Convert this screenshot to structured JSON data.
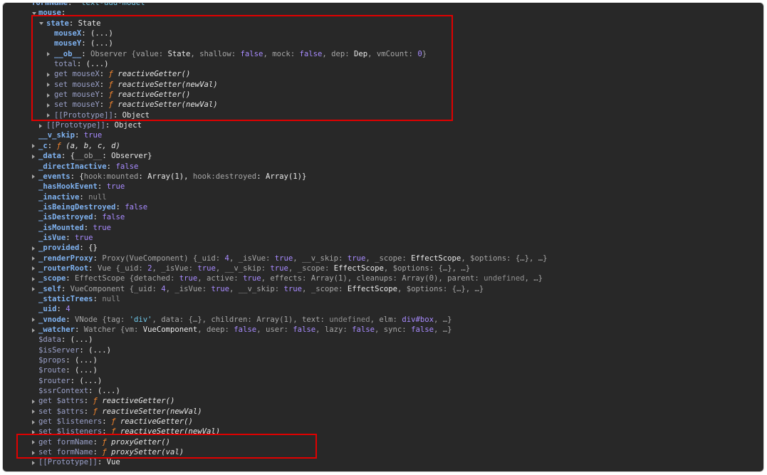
{
  "rows": [
    {
      "indent": 0,
      "tri": "none",
      "seg": [
        [
          "formName",
          "k-own"
        ],
        [
          ": ",
          "plain"
        ],
        [
          "'text-add-model'",
          "str"
        ]
      ]
    },
    {
      "indent": 1,
      "tri": "expanded",
      "seg": [
        [
          "mouse",
          "k-own"
        ],
        [
          ":",
          "plain"
        ]
      ]
    },
    {
      "indent": 2,
      "tri": "expanded",
      "seg": [
        [
          "state",
          "k-own"
        ],
        [
          ": State",
          "plain"
        ]
      ]
    },
    {
      "indent": 3,
      "tri": "none",
      "seg": [
        [
          "mouseX",
          "k-own"
        ],
        [
          ": (...)",
          "plain"
        ]
      ]
    },
    {
      "indent": 3,
      "tri": "none",
      "seg": [
        [
          "mouseY",
          "k-own"
        ],
        [
          ": (...)",
          "plain"
        ]
      ]
    },
    {
      "indent": 3,
      "tri": "collapsed",
      "seg": [
        [
          "__ob__",
          "k-own"
        ],
        [
          ": ",
          "plain"
        ],
        [
          "Observer ",
          "dim"
        ],
        [
          "{value: ",
          "dim"
        ],
        [
          "State",
          "bright"
        ],
        [
          ", shallow: ",
          "dim"
        ],
        [
          "false",
          "bool"
        ],
        [
          ", mock: ",
          "dim"
        ],
        [
          "false",
          "bool"
        ],
        [
          ", dep: ",
          "dim"
        ],
        [
          "Dep",
          "bright"
        ],
        [
          ", vmCount: ",
          "dim"
        ],
        [
          "0",
          "num"
        ],
        [
          "}",
          "dim"
        ]
      ]
    },
    {
      "indent": 3,
      "tri": "none",
      "seg": [
        [
          "total",
          "k-inh"
        ],
        [
          ": (...)",
          "plain"
        ]
      ]
    },
    {
      "indent": 3,
      "tri": "collapsed",
      "seg": [
        [
          "get mouseX",
          "k-inh"
        ],
        [
          ": ",
          "plain"
        ],
        [
          "ƒ ",
          "fsym"
        ],
        [
          "reactiveGetter()",
          "fname"
        ]
      ]
    },
    {
      "indent": 3,
      "tri": "collapsed",
      "seg": [
        [
          "set mouseX",
          "k-inh"
        ],
        [
          ": ",
          "plain"
        ],
        [
          "ƒ ",
          "fsym"
        ],
        [
          "reactiveSetter(newVal)",
          "fname"
        ]
      ]
    },
    {
      "indent": 3,
      "tri": "collapsed",
      "seg": [
        [
          "get mouseY",
          "k-inh"
        ],
        [
          ": ",
          "plain"
        ],
        [
          "ƒ ",
          "fsym"
        ],
        [
          "reactiveGetter()",
          "fname"
        ]
      ]
    },
    {
      "indent": 3,
      "tri": "collapsed",
      "seg": [
        [
          "set mouseY",
          "k-inh"
        ],
        [
          ": ",
          "plain"
        ],
        [
          "ƒ ",
          "fsym"
        ],
        [
          "reactiveSetter(newVal)",
          "fname"
        ]
      ]
    },
    {
      "indent": 3,
      "tri": "collapsed",
      "seg": [
        [
          "[[Prototype]]",
          "k-inh"
        ],
        [
          ": Object",
          "plain"
        ]
      ]
    },
    {
      "indent": 2,
      "tri": "collapsed",
      "seg": [
        [
          "[[Prototype]]",
          "k-inh"
        ],
        [
          ": Object",
          "plain"
        ]
      ]
    },
    {
      "indent": 1,
      "tri": "none",
      "seg": [
        [
          "__v_skip",
          "k-own"
        ],
        [
          ": ",
          "plain"
        ],
        [
          "true",
          "bool"
        ]
      ]
    },
    {
      "indent": 1,
      "tri": "collapsed",
      "seg": [
        [
          "_c",
          "k-own"
        ],
        [
          ": ",
          "plain"
        ],
        [
          "ƒ ",
          "fsym"
        ],
        [
          "(a, b, c, d)",
          "fname"
        ]
      ]
    },
    {
      "indent": 1,
      "tri": "collapsed",
      "seg": [
        [
          "_data",
          "k-own"
        ],
        [
          ": {",
          "plain"
        ],
        [
          "__ob__",
          "dim"
        ],
        [
          ": Observer}",
          "plain"
        ]
      ]
    },
    {
      "indent": 1,
      "tri": "none",
      "seg": [
        [
          "_directInactive",
          "k-own"
        ],
        [
          ": ",
          "plain"
        ],
        [
          "false",
          "bool"
        ]
      ]
    },
    {
      "indent": 1,
      "tri": "collapsed",
      "seg": [
        [
          "_events",
          "k-own"
        ],
        [
          ": {",
          "plain"
        ],
        [
          "hook:mounted",
          "dim"
        ],
        [
          ": Array(1), ",
          "plain"
        ],
        [
          "hook:destroyed",
          "dim"
        ],
        [
          ": Array(1)}",
          "plain"
        ]
      ]
    },
    {
      "indent": 1,
      "tri": "none",
      "seg": [
        [
          "_hasHookEvent",
          "k-own"
        ],
        [
          ": ",
          "plain"
        ],
        [
          "true",
          "bool"
        ]
      ]
    },
    {
      "indent": 1,
      "tri": "none",
      "seg": [
        [
          "_inactive",
          "k-own"
        ],
        [
          ": ",
          "plain"
        ],
        [
          "null",
          "null"
        ]
      ]
    },
    {
      "indent": 1,
      "tri": "none",
      "seg": [
        [
          "_isBeingDestroyed",
          "k-own"
        ],
        [
          ": ",
          "plain"
        ],
        [
          "false",
          "bool"
        ]
      ]
    },
    {
      "indent": 1,
      "tri": "none",
      "seg": [
        [
          "_isDestroyed",
          "k-own"
        ],
        [
          ": ",
          "plain"
        ],
        [
          "false",
          "bool"
        ]
      ]
    },
    {
      "indent": 1,
      "tri": "none",
      "seg": [
        [
          "_isMounted",
          "k-own"
        ],
        [
          ": ",
          "plain"
        ],
        [
          "true",
          "bool"
        ]
      ]
    },
    {
      "indent": 1,
      "tri": "none",
      "seg": [
        [
          "_isVue",
          "k-own"
        ],
        [
          ": ",
          "plain"
        ],
        [
          "true",
          "bool"
        ]
      ]
    },
    {
      "indent": 1,
      "tri": "collapsed",
      "seg": [
        [
          "_provided",
          "k-own"
        ],
        [
          ": {}",
          "plain"
        ]
      ]
    },
    {
      "indent": 1,
      "tri": "collapsed",
      "seg": [
        [
          "_renderProxy",
          "k-own"
        ],
        [
          ": ",
          "plain"
        ],
        [
          "Proxy(VueComponent) ",
          "dim"
        ],
        [
          "{",
          "dim"
        ],
        [
          "_uid",
          "dim"
        ],
        [
          ": ",
          "dim"
        ],
        [
          "4",
          "num"
        ],
        [
          ", ",
          "dim"
        ],
        [
          "_isVue",
          "dim"
        ],
        [
          ": ",
          "dim"
        ],
        [
          "true",
          "bool"
        ],
        [
          ", ",
          "dim"
        ],
        [
          "__v_skip",
          "dim"
        ],
        [
          ": ",
          "dim"
        ],
        [
          "true",
          "bool"
        ],
        [
          ", ",
          "dim"
        ],
        [
          "_scope",
          "dim"
        ],
        [
          ": ",
          "dim"
        ],
        [
          "EffectScope",
          "bright"
        ],
        [
          ", ",
          "dim"
        ],
        [
          "$options",
          "dim"
        ],
        [
          ": {…}, …}",
          "dim"
        ]
      ]
    },
    {
      "indent": 1,
      "tri": "collapsed",
      "seg": [
        [
          "_routerRoot",
          "k-own"
        ],
        [
          ": ",
          "plain"
        ],
        [
          "Vue ",
          "dim"
        ],
        [
          "{",
          "dim"
        ],
        [
          "_uid",
          "dim"
        ],
        [
          ": ",
          "dim"
        ],
        [
          "2",
          "num"
        ],
        [
          ", ",
          "dim"
        ],
        [
          "_isVue",
          "dim"
        ],
        [
          ": ",
          "dim"
        ],
        [
          "true",
          "bool"
        ],
        [
          ", ",
          "dim"
        ],
        [
          "__v_skip",
          "dim"
        ],
        [
          ": ",
          "dim"
        ],
        [
          "true",
          "bool"
        ],
        [
          ", ",
          "dim"
        ],
        [
          "_scope",
          "dim"
        ],
        [
          ": ",
          "dim"
        ],
        [
          "EffectScope",
          "bright"
        ],
        [
          ", ",
          "dim"
        ],
        [
          "$options",
          "dim"
        ],
        [
          ": {…}, …}",
          "dim"
        ]
      ]
    },
    {
      "indent": 1,
      "tri": "collapsed",
      "seg": [
        [
          "_scope",
          "k-own"
        ],
        [
          ": ",
          "plain"
        ],
        [
          "EffectScope ",
          "dim"
        ],
        [
          "{detached: ",
          "dim"
        ],
        [
          "true",
          "bool"
        ],
        [
          ", active: ",
          "dim"
        ],
        [
          "true",
          "bool"
        ],
        [
          ", effects: Array(1), cleanups: Array(0), parent: ",
          "dim"
        ],
        [
          "undefined",
          "null"
        ],
        [
          ", …}",
          "dim"
        ]
      ]
    },
    {
      "indent": 1,
      "tri": "collapsed",
      "seg": [
        [
          "_self",
          "k-own"
        ],
        [
          ": ",
          "plain"
        ],
        [
          "VueComponent ",
          "dim"
        ],
        [
          "{",
          "dim"
        ],
        [
          "_uid",
          "dim"
        ],
        [
          ": ",
          "dim"
        ],
        [
          "4",
          "num"
        ],
        [
          ", ",
          "dim"
        ],
        [
          "_isVue",
          "dim"
        ],
        [
          ": ",
          "dim"
        ],
        [
          "true",
          "bool"
        ],
        [
          ", ",
          "dim"
        ],
        [
          "__v_skip",
          "dim"
        ],
        [
          ": ",
          "dim"
        ],
        [
          "true",
          "bool"
        ],
        [
          ", ",
          "dim"
        ],
        [
          "_scope",
          "dim"
        ],
        [
          ": ",
          "dim"
        ],
        [
          "EffectScope",
          "bright"
        ],
        [
          ", ",
          "dim"
        ],
        [
          "$options",
          "dim"
        ],
        [
          ": {…}, …}",
          "dim"
        ]
      ]
    },
    {
      "indent": 1,
      "tri": "none",
      "seg": [
        [
          "_staticTrees",
          "k-own"
        ],
        [
          ": ",
          "plain"
        ],
        [
          "null",
          "null"
        ]
      ]
    },
    {
      "indent": 1,
      "tri": "none",
      "seg": [
        [
          "_uid",
          "k-own"
        ],
        [
          ": ",
          "plain"
        ],
        [
          "4",
          "num"
        ]
      ]
    },
    {
      "indent": 1,
      "tri": "collapsed",
      "seg": [
        [
          "_vnode",
          "k-own"
        ],
        [
          ": ",
          "plain"
        ],
        [
          "VNode ",
          "dim"
        ],
        [
          "{tag: ",
          "dim"
        ],
        [
          "'div'",
          "str"
        ],
        [
          ", data: {…}, children: Array(1), text: ",
          "dim"
        ],
        [
          "undefined",
          "null"
        ],
        [
          ", elm: ",
          "dim"
        ],
        [
          "div#box",
          "bool"
        ],
        [
          ", …}",
          "dim"
        ]
      ]
    },
    {
      "indent": 1,
      "tri": "collapsed",
      "seg": [
        [
          "_watcher",
          "k-own"
        ],
        [
          ": ",
          "plain"
        ],
        [
          "Watcher ",
          "dim"
        ],
        [
          "{vm: ",
          "dim"
        ],
        [
          "VueComponent",
          "bright"
        ],
        [
          ", deep: ",
          "dim"
        ],
        [
          "false",
          "bool"
        ],
        [
          ", user: ",
          "dim"
        ],
        [
          "false",
          "bool"
        ],
        [
          ", lazy: ",
          "dim"
        ],
        [
          "false",
          "bool"
        ],
        [
          ", sync: ",
          "dim"
        ],
        [
          "false",
          "bool"
        ],
        [
          ", …}",
          "dim"
        ]
      ]
    },
    {
      "indent": 1,
      "tri": "none",
      "seg": [
        [
          "$data",
          "k-inh"
        ],
        [
          ": (...)",
          "plain"
        ]
      ]
    },
    {
      "indent": 1,
      "tri": "none",
      "seg": [
        [
          "$isServer",
          "k-inh"
        ],
        [
          ": (...)",
          "plain"
        ]
      ]
    },
    {
      "indent": 1,
      "tri": "none",
      "seg": [
        [
          "$props",
          "k-inh"
        ],
        [
          ": (...)",
          "plain"
        ]
      ]
    },
    {
      "indent": 1,
      "tri": "none",
      "seg": [
        [
          "$route",
          "k-inh"
        ],
        [
          ": (...)",
          "plain"
        ]
      ]
    },
    {
      "indent": 1,
      "tri": "none",
      "seg": [
        [
          "$router",
          "k-inh"
        ],
        [
          ": (...)",
          "plain"
        ]
      ]
    },
    {
      "indent": 1,
      "tri": "none",
      "seg": [
        [
          "$ssrContext",
          "k-inh"
        ],
        [
          ": (...)",
          "plain"
        ]
      ]
    },
    {
      "indent": 1,
      "tri": "collapsed",
      "seg": [
        [
          "get $attrs",
          "k-inh"
        ],
        [
          ": ",
          "plain"
        ],
        [
          "ƒ ",
          "fsym"
        ],
        [
          "reactiveGetter()",
          "fname"
        ]
      ]
    },
    {
      "indent": 1,
      "tri": "collapsed",
      "seg": [
        [
          "set $attrs",
          "k-inh"
        ],
        [
          ": ",
          "plain"
        ],
        [
          "ƒ ",
          "fsym"
        ],
        [
          "reactiveSetter(newVal)",
          "fname"
        ]
      ]
    },
    {
      "indent": 1,
      "tri": "collapsed",
      "seg": [
        [
          "get $listeners",
          "k-inh"
        ],
        [
          ": ",
          "plain"
        ],
        [
          "ƒ ",
          "fsym"
        ],
        [
          "reactiveGetter()",
          "fname"
        ]
      ]
    },
    {
      "indent": 1,
      "tri": "collapsed",
      "seg": [
        [
          "set $listeners",
          "k-inh"
        ],
        [
          ": ",
          "plain"
        ],
        [
          "ƒ ",
          "fsym"
        ],
        [
          "reactiveSetter(newVal)",
          "fname"
        ]
      ]
    },
    {
      "indent": 1,
      "tri": "collapsed",
      "seg": [
        [
          "get formName",
          "k-inh"
        ],
        [
          ": ",
          "plain"
        ],
        [
          "ƒ ",
          "fsym"
        ],
        [
          "proxyGetter()",
          "fname"
        ]
      ]
    },
    {
      "indent": 1,
      "tri": "collapsed",
      "seg": [
        [
          "set formName",
          "k-inh"
        ],
        [
          ": ",
          "plain"
        ],
        [
          "ƒ ",
          "fsym"
        ],
        [
          "proxySetter(val)",
          "fname"
        ]
      ]
    },
    {
      "indent": 1,
      "tri": "collapsed",
      "seg": [
        [
          "[[Prototype]]",
          "k-inh"
        ],
        [
          ": Vue",
          "plain"
        ]
      ]
    }
  ],
  "highlights": [
    {
      "name": "state-highlight-box",
      "from_row": 2,
      "to_row": 11
    },
    {
      "name": "formname-accessors-highlight-box",
      "from_row": 43,
      "to_row": 44
    }
  ]
}
